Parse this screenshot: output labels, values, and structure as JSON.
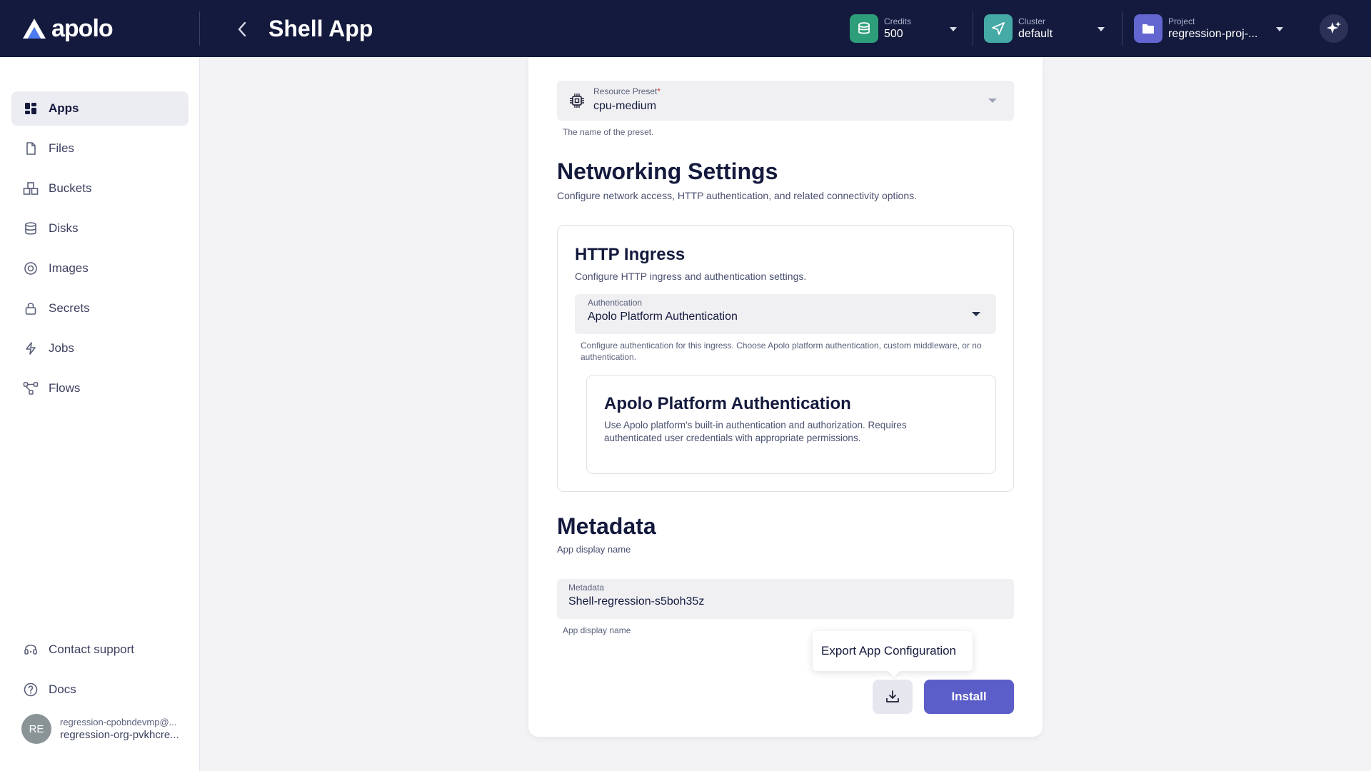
{
  "brand": {
    "logo_text": "apolo"
  },
  "header": {
    "title": "Shell App",
    "credits": {
      "label": "Credits",
      "value": "500",
      "icon": "coins-icon",
      "color": "#2e9e7a"
    },
    "cluster": {
      "label": "Cluster",
      "value": "default",
      "icon": "send-icon",
      "color": "#45a9a6"
    },
    "project": {
      "label": "Project",
      "value": "regression-proj-...",
      "icon": "folder-icon",
      "color": "#6366d1"
    },
    "ai_icon": "sparkles-icon"
  },
  "sidebar": {
    "items": [
      {
        "label": "Apps",
        "icon": "apps-icon",
        "active": true
      },
      {
        "label": "Files",
        "icon": "file-icon"
      },
      {
        "label": "Buckets",
        "icon": "buckets-icon"
      },
      {
        "label": "Disks",
        "icon": "database-icon"
      },
      {
        "label": "Images",
        "icon": "images-icon"
      },
      {
        "label": "Secrets",
        "icon": "lock-icon"
      },
      {
        "label": "Jobs",
        "icon": "lightning-icon"
      },
      {
        "label": "Flows",
        "icon": "flows-icon"
      }
    ],
    "bottom": [
      {
        "label": "Contact support",
        "icon": "headset-icon"
      },
      {
        "label": "Docs",
        "icon": "help-circle-icon"
      }
    ],
    "user": {
      "initials": "RE",
      "email": "regression-cpobndevmp@...",
      "org": "regression-org-pvkhcre..."
    }
  },
  "form": {
    "resource_preset": {
      "label": "Resource Preset",
      "required_mark": "*",
      "value": "cpu-medium",
      "helper": "The name of the preset.",
      "icon": "chip-icon"
    },
    "networking": {
      "title": "Networking Settings",
      "description": "Configure network access, HTTP authentication, and related connectivity options.",
      "http_ingress": {
        "title": "HTTP Ingress",
        "description": "Configure HTTP ingress and authentication settings.",
        "auth_field": {
          "label": "Authentication",
          "value": "Apolo Platform Authentication",
          "helper": "Configure authentication for this ingress. Choose Apolo platform authentication, custom middleware, or no authentication."
        },
        "auth_panel": {
          "title": "Apolo Platform Authentication",
          "description": "Use Apolo platform's built-in authentication and authorization. Requires authenticated user credentials with appropriate permissions."
        }
      }
    },
    "metadata": {
      "title": "Metadata",
      "description": "App display name",
      "field": {
        "label": "Metadata",
        "value": "Shell-regression-s5boh35z",
        "helper": "App display name"
      }
    },
    "actions": {
      "tooltip": "Export App Configuration",
      "export_icon": "download-icon",
      "install_label": "Install"
    }
  }
}
